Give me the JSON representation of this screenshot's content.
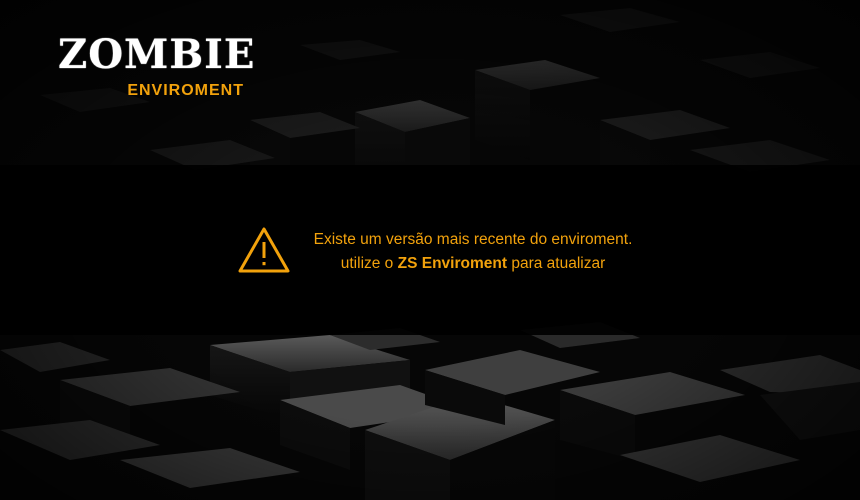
{
  "brand": {
    "title": "ZOMBIE",
    "subtitle": "ENVIROMENT",
    "accent_color": "#f2a20c"
  },
  "notice": {
    "icon": "warning-triangle-icon",
    "line1": "Existe um versão mais recente do enviroment.",
    "line2_prefix": "utilize o",
    "line2_highlight": "ZS Enviroment",
    "line2_suffix": "para atualizar"
  },
  "background": {
    "description_icon": "dark-3d-cubes-background"
  }
}
